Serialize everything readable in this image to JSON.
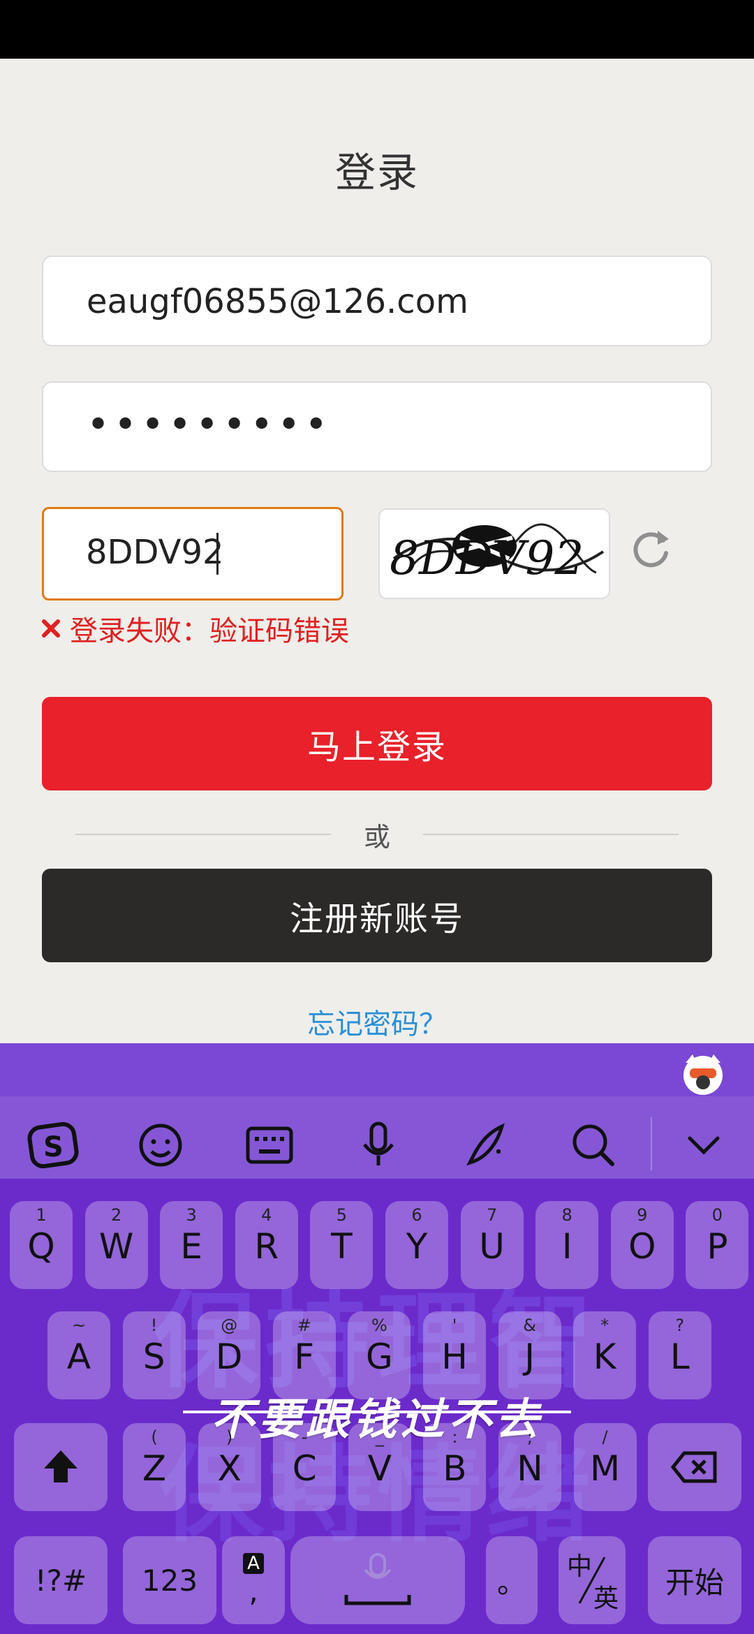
{
  "login": {
    "title": "登录",
    "email_value": "eaugf06855@126.com",
    "password_mask": "•••••••••",
    "captcha_value": "8DDV92",
    "captcha_image_text": "8DDV92",
    "error_message": "登录失败：验证码错误",
    "login_button": "马上登录",
    "or_text": "或",
    "register_button": "注册新账号",
    "forgot_link": "忘记密码？"
  },
  "keyboard": {
    "toolbar": [
      "sogou-logo-icon",
      "emoji-icon",
      "keyboard-icon",
      "microphone-icon",
      "handwriting-icon",
      "search-icon",
      "chevron-down-icon"
    ],
    "row1": [
      {
        "num": "1",
        "ch": "Q"
      },
      {
        "num": "2",
        "ch": "W"
      },
      {
        "num": "3",
        "ch": "E"
      },
      {
        "num": "4",
        "ch": "R"
      },
      {
        "num": "5",
        "ch": "T"
      },
      {
        "num": "6",
        "ch": "Y"
      },
      {
        "num": "7",
        "ch": "U"
      },
      {
        "num": "8",
        "ch": "I"
      },
      {
        "num": "9",
        "ch": "O"
      },
      {
        "num": "0",
        "ch": "P"
      }
    ],
    "row2": [
      {
        "num": "~",
        "ch": "A"
      },
      {
        "num": "!",
        "ch": "S"
      },
      {
        "num": "@",
        "ch": "D"
      },
      {
        "num": "#",
        "ch": "F"
      },
      {
        "num": "%",
        "ch": "G"
      },
      {
        "num": "'",
        "ch": "H"
      },
      {
        "num": "&",
        "ch": "J"
      },
      {
        "num": "*",
        "ch": "K"
      },
      {
        "num": "?",
        "ch": "L"
      }
    ],
    "row3": [
      {
        "num": "(",
        "ch": "Z"
      },
      {
        "num": ")",
        "ch": "X"
      },
      {
        "num": "-",
        "ch": "C"
      },
      {
        "num": "_",
        "ch": "V"
      },
      {
        "num": ":",
        "ch": "B"
      },
      {
        "num": ";",
        "ch": "N"
      },
      {
        "num": "/",
        "ch": "M"
      }
    ],
    "symbols_key": "!?#",
    "numbers_key": "123",
    "comma_key": ",",
    "comma_badge": "A",
    "period_key": "。",
    "lang_key_top": "中",
    "lang_key_bottom": "英",
    "enter_key": "开始",
    "watermark_line1": "保持理智",
    "watermark_line2": "保持情绪",
    "slogan": "不要跟钱过不去"
  }
}
